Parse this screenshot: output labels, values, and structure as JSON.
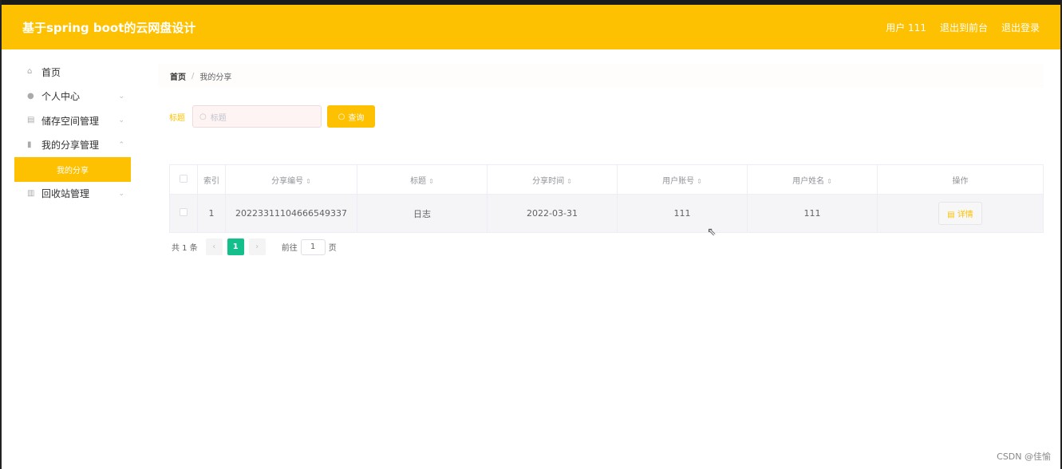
{
  "header": {
    "title": "基于spring boot的云网盘设计",
    "user": "用户 111",
    "to_front": "退出到前台",
    "logout": "退出登录"
  },
  "sidebar": {
    "items": [
      {
        "label": "首页",
        "icon": "home-icon"
      },
      {
        "label": "个人中心",
        "icon": "user-icon"
      },
      {
        "label": "储存空间管理",
        "icon": "storage-icon"
      },
      {
        "label": "我的分享管理",
        "icon": "chart-icon"
      },
      {
        "label": "我的分享",
        "active": true
      },
      {
        "label": "回收站管理",
        "icon": "trash-icon"
      }
    ]
  },
  "breadcrumb": {
    "home": "首页",
    "sep": "/",
    "current": "我的分享"
  },
  "search": {
    "label": "标题",
    "placeholder": "标题",
    "button": "查询"
  },
  "table": {
    "columns": [
      "索引",
      "分享编号",
      "标题",
      "分享时间",
      "用户账号",
      "用户姓名",
      "操作"
    ],
    "rows": [
      {
        "index": "1",
        "share_no": "20223311104666549337",
        "title": "日志",
        "time": "2022-03-31",
        "account": "111",
        "name": "111",
        "action": "详情"
      }
    ]
  },
  "pagination": {
    "total": "共 1 条",
    "current": "1",
    "goto": "前往",
    "goto_value": "1",
    "page_suffix": "页"
  },
  "watermark": "CSDN @佳愉"
}
